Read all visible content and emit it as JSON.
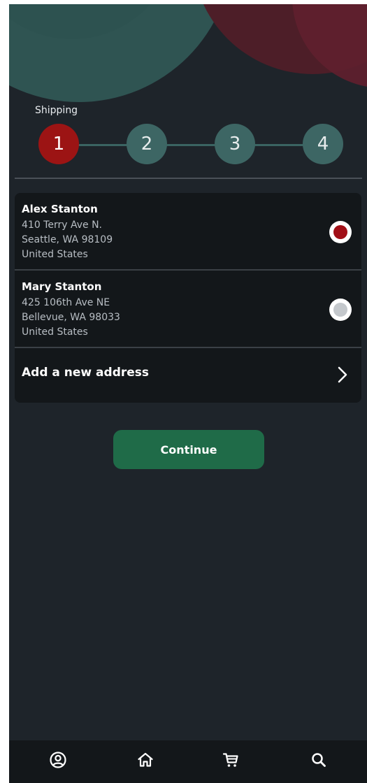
{
  "stepper": {
    "title": "Shipping",
    "steps": [
      {
        "label": "1",
        "active": true
      },
      {
        "label": "2",
        "active": false
      },
      {
        "label": "3",
        "active": false
      },
      {
        "label": "4",
        "active": false
      }
    ]
  },
  "addresses": [
    {
      "name": "Alex Stanton",
      "line1": "410 Terry Ave N.",
      "line2": "Seattle, WA 98109",
      "line3": "United States",
      "selected": true
    },
    {
      "name": "Mary Stanton",
      "line1": "425 106th Ave NE",
      "line2": "Bellevue, WA 98033",
      "line3": "United States",
      "selected": false
    }
  ],
  "add_address": {
    "label": "Add a new address",
    "icon": "chevron-right-icon"
  },
  "continue_button": {
    "label": "Continue"
  },
  "bottom_nav": [
    {
      "icon": "profile-icon"
    },
    {
      "icon": "home-icon"
    },
    {
      "icon": "cart-icon"
    },
    {
      "icon": "search-icon"
    }
  ],
  "colors": {
    "background": "#1e242a",
    "card": "#13171a",
    "accent_red": "#9c1414",
    "step_inactive": "#3d6664",
    "button_green": "#1f6b48"
  }
}
